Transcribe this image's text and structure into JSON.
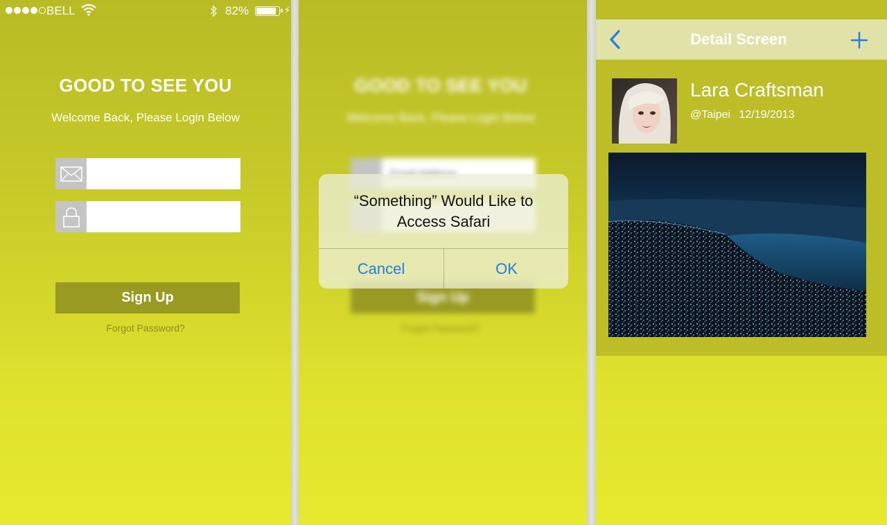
{
  "status_bar": {
    "carrier": "BELL",
    "signal_dots_filled": 4,
    "battery_percent": "82%",
    "battery_level": 0.82,
    "icons": [
      "wifi-icon",
      "bluetooth-icon",
      "battery-icon",
      "charging-icon"
    ]
  },
  "login": {
    "title": "GOOD TO SEE YOU",
    "subtitle": "Welcome Back, Please Login Below",
    "email_icon": "envelope-icon",
    "password_icon": "lock-icon",
    "signup_label": "Sign Up",
    "forgot_label": "Forgot Password?"
  },
  "alert_screen": {
    "email_placeholder": "Email Address",
    "alert": {
      "message": "“Something” Would Like to Access Safari",
      "cancel_label": "Cancel",
      "ok_label": "OK"
    }
  },
  "detail": {
    "nav_title": "Detail Screen",
    "back_icon": "chevron-left-icon",
    "add_icon": "plus-icon",
    "name": "Lara Craftsman",
    "handle": "@Taipei",
    "date": "12/19/2013",
    "photo": "city-night-photo"
  },
  "colors": {
    "background_top": "#b9bb26",
    "background_bottom": "#e6e92f",
    "button": "#999a22",
    "navbar": "#e0e2a7",
    "ios_blue": "#1e7ee6"
  }
}
